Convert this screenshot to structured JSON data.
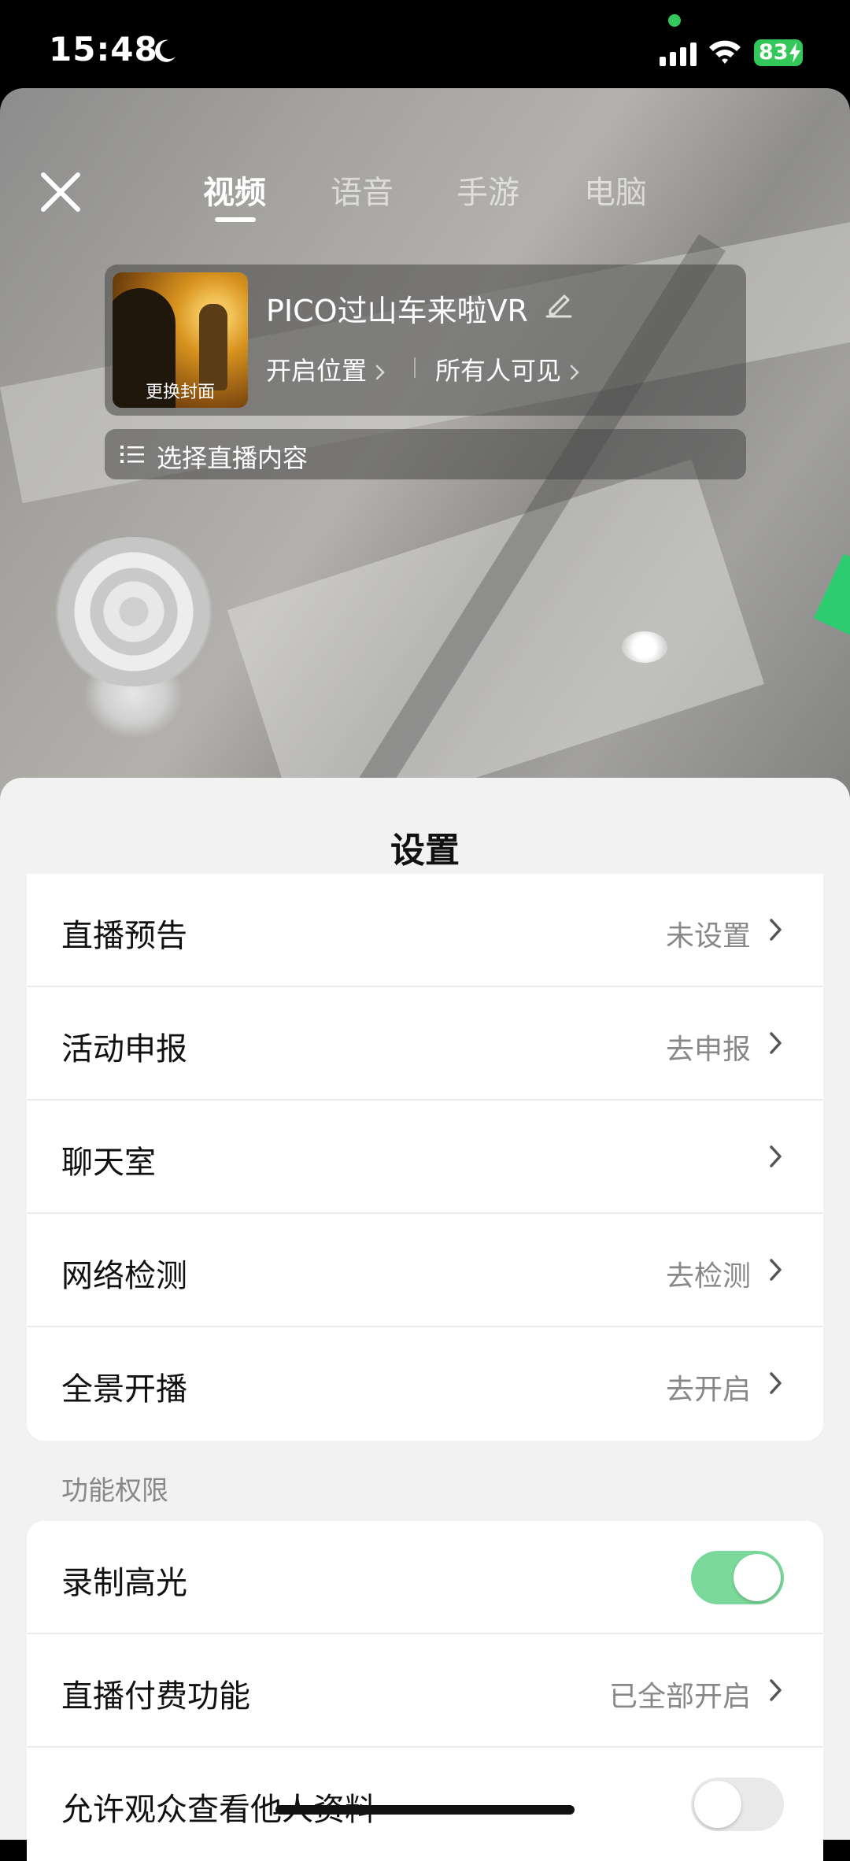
{
  "status_bar": {
    "time": "15:48",
    "battery": "83"
  },
  "top_tabs": [
    {
      "label": "视频",
      "active": true
    },
    {
      "label": "语音",
      "active": false
    },
    {
      "label": "手游",
      "active": false
    },
    {
      "label": "电脑",
      "active": false
    }
  ],
  "live_info": {
    "cover_label": "更换封面",
    "title": "PICO过山车来啦VR",
    "location_label": "开启位置",
    "visibility_label": "所有人可见",
    "content_label": "选择直播内容"
  },
  "settings_sheet": {
    "title": "设置",
    "rows": [
      {
        "label": "直播预告",
        "value": "未设置"
      },
      {
        "label": "活动申报",
        "value": "去申报"
      },
      {
        "label": "聊天室",
        "value": ""
      },
      {
        "label": "网络检测",
        "value": "去检测"
      },
      {
        "label": "全景开播",
        "value": "去开启"
      }
    ],
    "permissions_header": "功能权限",
    "permission_rows": [
      {
        "label": "录制高光",
        "toggle": true
      },
      {
        "label": "直播付费功能",
        "value": "已全部开启"
      },
      {
        "label": "允许观众查看他人资料",
        "toggle": false
      }
    ]
  },
  "colors": {
    "toggle_on": "#7ad99a",
    "battery": "#34c759"
  }
}
